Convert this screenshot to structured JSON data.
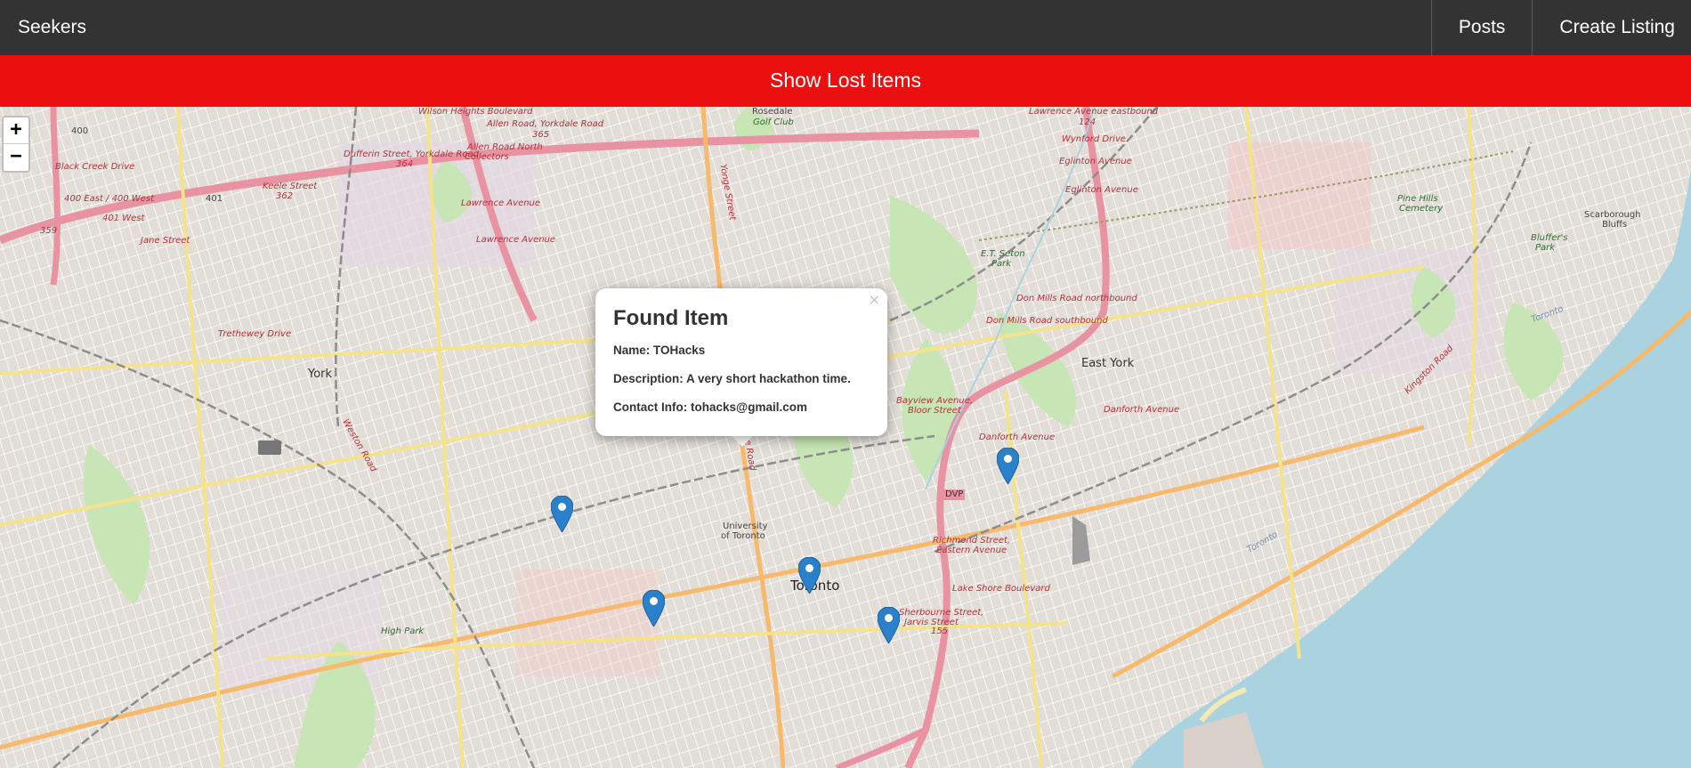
{
  "navbar": {
    "brand": "Seekers",
    "posts_label": "Posts",
    "create_label": "Create Listing"
  },
  "toggle": {
    "label": "Show Lost Items"
  },
  "map": {
    "zoom_in": "+",
    "zoom_out": "−",
    "labels": {
      "wilson_heights": "Wilson Heights Boulevard",
      "rosedale": "Rosedale",
      "golf_club": "Golf Club",
      "lawrence_east": "Lawrence Avenue eastbound",
      "hwy_124": "124",
      "allen_road": "Allen Road, Yorkdale Road",
      "n365": "365",
      "allen_north": "Allen Road North",
      "collectors": "Collectors",
      "hwy400": "400",
      "black_creek": "Black Creek Drive",
      "n400w": "400 East / 400 West",
      "hwy401": "401",
      "n401w": "401 West",
      "n359": "359",
      "jane": "Jane Street",
      "keele": "Keele Street",
      "n362": "362",
      "dufferin_yorkdale": "Dufferin Street, Yorkdale Road",
      "n364": "364",
      "lawrence1": "Lawrence Avenue",
      "lawrence2": "Lawrence Avenue",
      "wynford": "Wynford Drive",
      "eglinton1": "Eglinton Avenue",
      "eglinton2": "Eglinton Avenue",
      "pine_hills": "Pine Hills",
      "cemetery": "Cemetery",
      "scarborough": "Scarborough",
      "bluffs": "Bluffs",
      "bluffer": "Bluffer's",
      "park": "Park",
      "et_seton": "E.T. Seton",
      "park2": "Park",
      "don_mills_n": "Don Mills Road northbound",
      "don_mills_s": "Don Mills Road southbound",
      "york": "York",
      "east_york": "East York",
      "trethewey": "Trethewey Drive",
      "bayview": "Bayview Avenue,",
      "bloor": "Bloor Street",
      "danforth1": "Danforth Avenue",
      "danforth2": "Danforth Avenue",
      "dvp": "DVP",
      "university": "University",
      "of_toronto": "of Toronto",
      "toronto": "Toronto",
      "richmond": "Richmond Street,",
      "eastern": "Eastern Avenue",
      "lake_shore": "Lake Shore Boulevard",
      "sherbourne": "Sherbourne Street,",
      "jarvis": "Jarvis Street",
      "n155": "155",
      "high_park": "High Park",
      "toronto_water": "Toronto",
      "toronto_water2": "Toronto",
      "avenue_road": "Avenue Road",
      "yonge": "Yonge Street",
      "weston": "Weston Road",
      "kingston": "Kingston Road"
    }
  },
  "popup": {
    "close": "×",
    "title": "Found Item",
    "name_label": "Name:",
    "name": "TOHacks",
    "description_label": "Description:",
    "description": "A very short hackathon time.",
    "contact_label": "Contact Info:",
    "contact": "tohacks@gmail.com"
  },
  "colors": {
    "navbar": "#333333",
    "toggle_bar": "#eb1010",
    "marker": "#2a81cb",
    "water": "#aad3df",
    "highway": "#e892a2"
  },
  "icons": {
    "marker": "map-marker-icon",
    "close": "close-icon"
  }
}
